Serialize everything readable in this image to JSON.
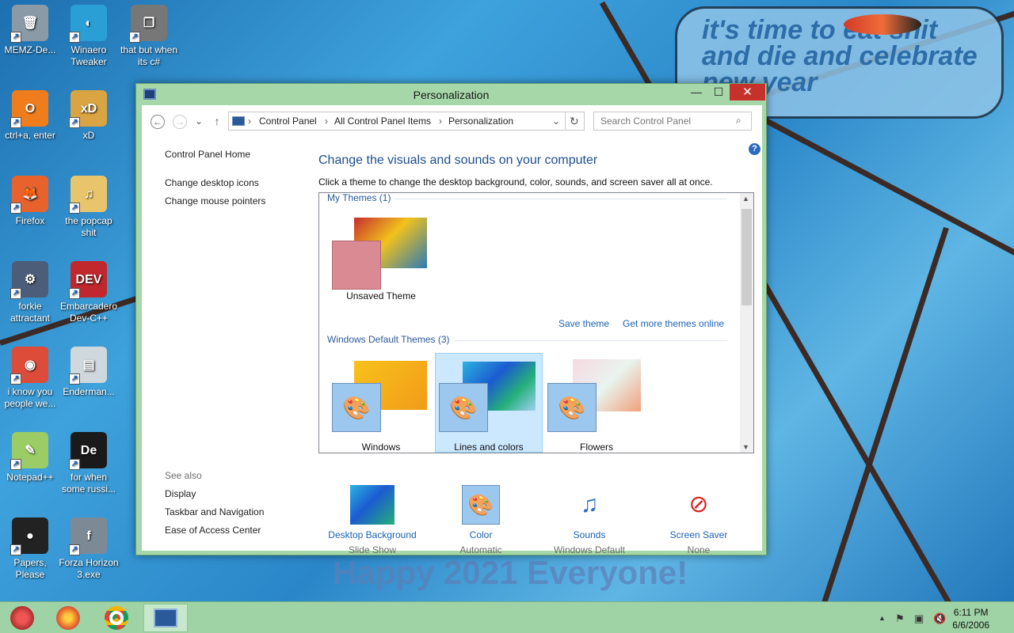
{
  "wallpaper": {
    "text_line1": "it's time to eat shit",
    "text_line2": "and die and celebrate",
    "text_line3": "new year",
    "bottom_text": "Happy 2021 Everyone!"
  },
  "desktop_icons": [
    {
      "label": "MEMZ-De...",
      "icon": "recycle-bin-icon",
      "color": "#8a9aa6",
      "glyph": "🗑"
    },
    {
      "label": "ctrl+a, enter",
      "icon": "magnifier-icon",
      "color": "#f07d1c",
      "glyph": "O"
    },
    {
      "label": "Firefox",
      "icon": "firefox-icon",
      "color": "#e7622c",
      "glyph": "🦊"
    },
    {
      "label": "forkie attractant",
      "icon": "settings-monitor-icon",
      "color": "#4b5d78",
      "glyph": "⚙"
    },
    {
      "label": "i know you people we...",
      "icon": "chrome-icon",
      "color": "#dd4b39",
      "glyph": "◉"
    },
    {
      "label": "Notepad++",
      "icon": "notepad-icon",
      "color": "#9ccc65",
      "glyph": "✎"
    },
    {
      "label": "Papers, Please",
      "icon": "papers-please-icon",
      "color": "#222222",
      "glyph": "●"
    },
    {
      "label": "Winaero Tweaker",
      "icon": "winaero-icon",
      "color": "#2a9fd6",
      "glyph": "◐"
    },
    {
      "label": "xD",
      "icon": "hxd-icon",
      "color": "#d9a441",
      "glyph": "xD"
    },
    {
      "label": "the popcap shit",
      "icon": "music-folder-icon",
      "color": "#e8c46d",
      "glyph": "♫"
    },
    {
      "label": "Embarcadero Dev-C++",
      "icon": "devcpp-icon",
      "color": "#c0282d",
      "glyph": "DEV"
    },
    {
      "label": "Enderman...",
      "icon": "document-icon",
      "color": "#cfd8dc",
      "glyph": "▤"
    },
    {
      "label": "for when some russi...",
      "icon": "de-icon",
      "color": "#1a1a1a",
      "glyph": "De"
    },
    {
      "label": "Forza Horizon 3.exe",
      "icon": "flash-icon",
      "color": "#7d8a96",
      "glyph": "f"
    },
    {
      "label": "that but when its c#",
      "icon": "windows-stack-icon",
      "color": "#777777",
      "glyph": "❐"
    }
  ],
  "window": {
    "title": "Personalization",
    "min": "—",
    "max": "☐",
    "close": "✕"
  },
  "address": {
    "back": "←",
    "forward": "→",
    "recent": "⌄",
    "up": "↑",
    "crumbs": [
      "Control Panel",
      "All Control Panel Items",
      "Personalization"
    ],
    "sep": "›",
    "dropdown": "⌄",
    "refresh": "↻",
    "search_placeholder": "Search Control Panel",
    "help": "?"
  },
  "left_nav": {
    "home": "Control Panel Home",
    "items": [
      "Change desktop icons",
      "Change mouse pointers"
    ],
    "see_also": "See also",
    "see_also_items": [
      "Display",
      "Taskbar and Navigation",
      "Ease of Access Center"
    ]
  },
  "main": {
    "title": "Change the visuals and sounds on your computer",
    "desc": "Click a theme to change the desktop background, color, sounds, and screen saver all at once."
  },
  "themes": {
    "my_header": "My Themes (1)",
    "unsaved": "Unsaved Theme",
    "save": "Save theme",
    "get_more": "Get more themes online",
    "default_header": "Windows Default Themes (3)",
    "defaults": [
      "Windows",
      "Lines and colors",
      "Flowers"
    ],
    "selected_index": 1
  },
  "bottom": [
    {
      "label": "Desktop Background",
      "sub": "Slide Show",
      "icon": "desktop-background-icon"
    },
    {
      "label": "Color",
      "sub": "Automatic",
      "icon": "color-palette-icon"
    },
    {
      "label": "Sounds",
      "sub": "Windows Default",
      "icon": "sounds-icon"
    },
    {
      "label": "Screen Saver",
      "sub": "None",
      "icon": "screen-saver-icon"
    }
  ],
  "taskbar": {
    "time": "6:11 PM",
    "date": "6/6/2006",
    "tray_chevron": "▲"
  },
  "colors": {
    "titlebar": "#a6d7a8",
    "close": "#c7312b",
    "link": "#1c63b7",
    "heading": "#1e4e8c",
    "selected": "#cce8ff"
  }
}
